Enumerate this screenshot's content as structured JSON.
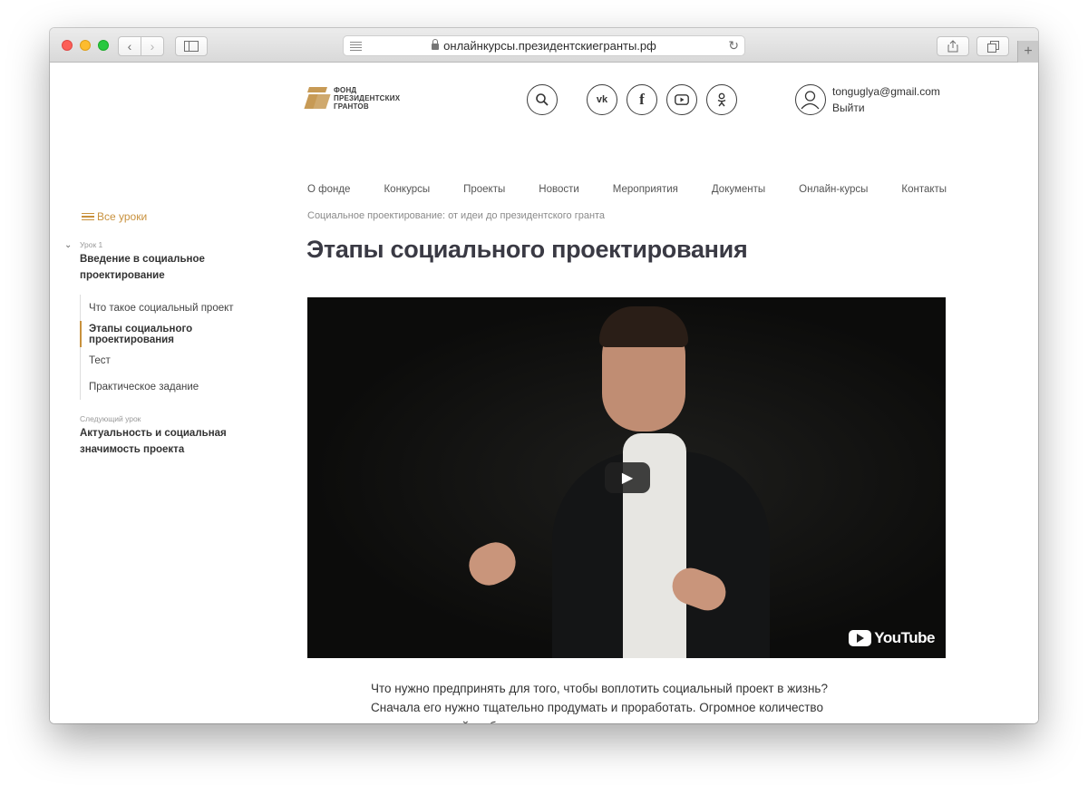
{
  "browser": {
    "url": "онлайнкурсы.президентскиегранты.рф"
  },
  "logo": {
    "line1": "ФОНД",
    "line2": "ПРЕЗИДЕНТСКИХ",
    "line3": "ГРАНТОВ",
    "brand_color": "#c79a55"
  },
  "header_icons": [
    "search-icon",
    "vk-icon",
    "facebook-icon",
    "youtube-icon",
    "odnoklassniki-icon"
  ],
  "user": {
    "email": "tonguglya@gmail.com",
    "logout": "Выйти"
  },
  "nav": {
    "items": [
      "О фонде",
      "Конкурсы",
      "Проекты",
      "Новости",
      "Мероприятия",
      "Документы",
      "Онлайн-курсы",
      "Контакты"
    ]
  },
  "sidebar": {
    "all_lessons": "Все уроки",
    "accent_color": "#c8913d",
    "current_lesson_label": "Урок 1",
    "current_lesson_title": "Введение в социальное проектирование",
    "sublessons": [
      {
        "label": "Что такое социальный проект",
        "active": false
      },
      {
        "label": "Этапы социального проектирования",
        "active": true
      },
      {
        "label": "Тест",
        "active": false
      },
      {
        "label": "Практическое задание",
        "active": false
      }
    ],
    "next_lesson_label": "Следующий урок",
    "next_lesson_title": "Актуальность и социальная значимость проекта"
  },
  "main": {
    "breadcrumb": "Социальное проектирование: от идеи до президентского гранта",
    "title": "Этапы социального проектирования",
    "video": {
      "provider": "YouTube"
    },
    "paragraphs": [
      "Что нужно предпринять для того, чтобы воплотить социальный проект в жизнь?",
      "Сначала его нужно тщательно продумать и проработать. Огромное количество прекрасных идей не было реализовано из-за неправильного планирования и непонимания механизма работы с проектом. Что значит проработать проект? Это значит обеспечить логическую"
    ]
  }
}
